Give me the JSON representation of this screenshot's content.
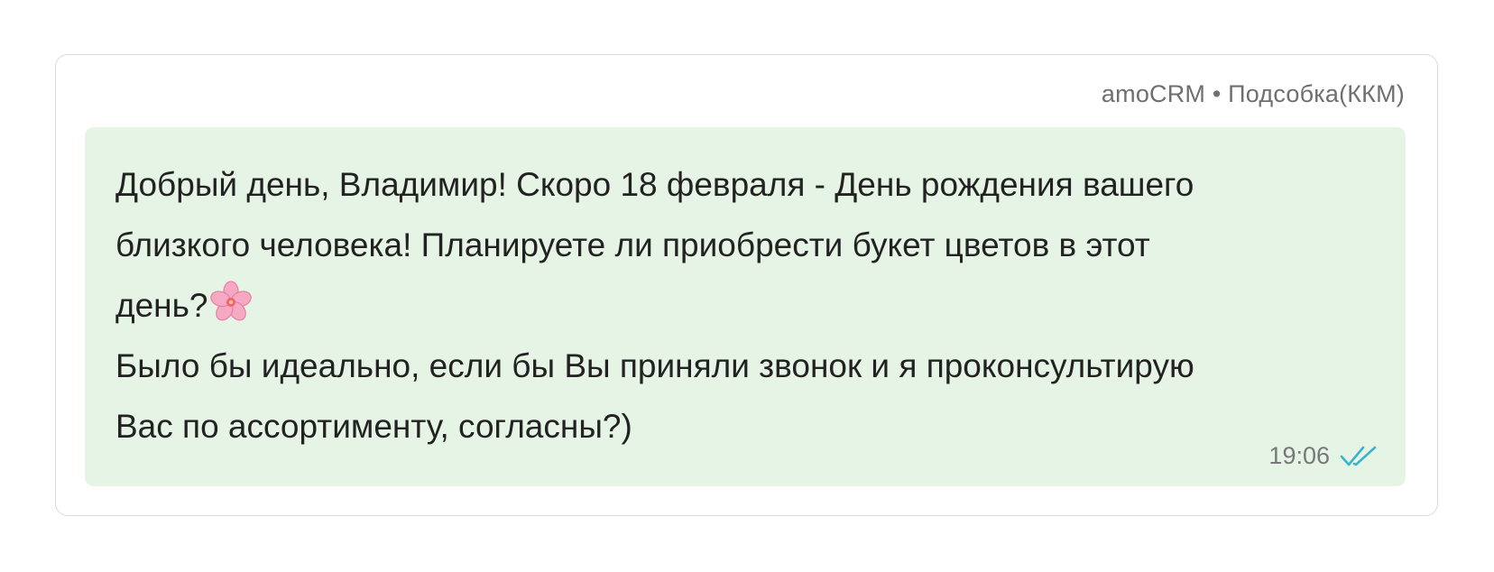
{
  "message": {
    "header": "amoCRM • Подсобка(ККМ)",
    "lines": [
      "Добрый день, Владимир! Скоро 18 февраля - День рождения вашего",
      "близкого человека! Планируете ли приобрести букет цветов в этот",
      "день?",
      "Было бы идеально, если бы Вы приняли звонок и я проконсультирую",
      "Вас по ассортименту, согласны?)"
    ],
    "emoji": "cherry-blossom-icon",
    "time": "19:06",
    "status_icon": "double-check-icon",
    "colors": {
      "bubble": "#e6f4e6",
      "check": "#3ab4c8",
      "text": "#222222",
      "meta": "#6f6f6f"
    }
  }
}
